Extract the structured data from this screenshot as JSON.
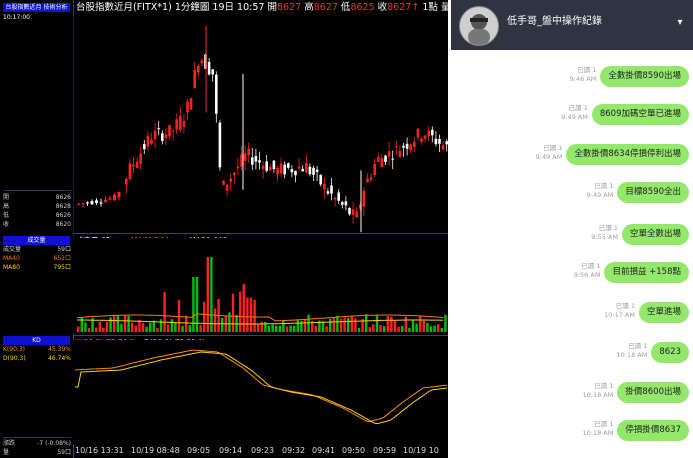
{
  "left_panel": {
    "header": "台股指數近月 技術分析",
    "time": "10:17:00",
    "quotes": [
      {
        "label": "開",
        "value": "8626"
      },
      {
        "label": "高",
        "value": "8628"
      },
      {
        "label": "低",
        "value": "8626"
      },
      {
        "label": "收",
        "value": "8620"
      }
    ],
    "volume_header": "成交量",
    "volume_rows": [
      {
        "label": "成交量",
        "value": "59口"
      },
      {
        "label": "MA40",
        "value": "652口"
      },
      {
        "label": "MA80",
        "value": "795口"
      }
    ],
    "kd_header": "KD",
    "kd_rows": [
      {
        "label": "K(90,3)",
        "value": "45.39%"
      },
      {
        "label": "D(90,3)",
        "value": "46.74%"
      }
    ],
    "bottom_rows": [
      {
        "label": "漲跌",
        "value": "-7 (-0.08%)"
      },
      {
        "label": "量",
        "value": "59口"
      }
    ]
  },
  "chart_top": {
    "name": "台股指數近月(FITX*1)",
    "interval": "1分鐘圖",
    "day": "19日",
    "time": "10:57",
    "open_label": "開",
    "open_value": "8627",
    "high_label": "高",
    "high_value": "8627",
    "low_label": "低",
    "low_value": "8625",
    "close_label": "收",
    "close_value": "8627",
    "change": "1點",
    "volume_label": "量",
    "volume_value": "62"
  },
  "volume_legend": {
    "vol": "成交量 62",
    "ma40": "MA40 244",
    "ma80": "MA80 448"
  },
  "kd_legend": {
    "k": "K(90,3) 77.74 %",
    "d": "D(90,3) 73.21 %"
  },
  "time_axis": [
    "10/16 13:31",
    "10/19 08:48",
    "09:05",
    "09:14",
    "09:23",
    "09:32",
    "09:41",
    "09:50",
    "09:59",
    "10/19 10"
  ],
  "chat": {
    "title": "低手哥_盤中操作紀錄",
    "read_label": "已讀 1",
    "messages": [
      {
        "text": "全數掛價8590出場",
        "time": "9:46 AM"
      },
      {
        "text": "8609加碼空單已進場",
        "time": "9:49 AM"
      },
      {
        "text": "全數掛價8634停損停利出場",
        "time": "9:49 AM"
      },
      {
        "text": "目標8590全出",
        "time": "9:49 AM"
      },
      {
        "text": "空單全數出場",
        "time": "9:55 AM"
      },
      {
        "text": "目前損益 +158點",
        "time": "9:56 AM"
      },
      {
        "text": "空單進場",
        "time": "10:17 AM"
      },
      {
        "text": "8623",
        "time": "10:18 AM"
      },
      {
        "text": "掛價8600出場",
        "time": "10:18 AM"
      },
      {
        "text": "停損掛價8637",
        "time": "10:18 AM"
      }
    ]
  },
  "chart_data": {
    "type": "candlestick",
    "interval": "1分鐘圖",
    "price_segments": [
      {
        "name": "10/16 13:31",
        "approx_price_range": [
          8590,
          8600
        ]
      },
      {
        "name": "10/19 session",
        "approx_price_range": [
          8595,
          8680
        ]
      }
    ],
    "kd": {
      "k": 77.74,
      "d": 73.21
    },
    "volume": {
      "last": 62,
      "ma40": 244,
      "ma80": 448
    },
    "colors": {
      "up": "#ff2020",
      "down": "#ffffff",
      "ma40": "#ff7a00",
      "ma80": "#ffd000",
      "k": "#ff8c00",
      "d": "#ffd200"
    }
  },
  "colors": {
    "accent_red": "#ff2a2a",
    "panel_blue": "#1010d0",
    "bubble_green": "#93e86b",
    "header_dark": "#2f3440"
  }
}
